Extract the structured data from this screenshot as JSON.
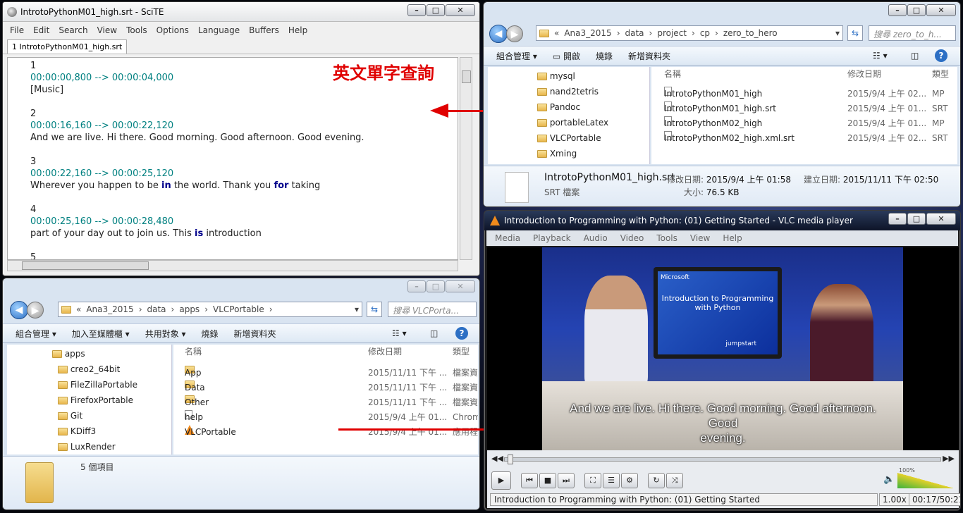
{
  "scite": {
    "title": "IntrotoPythonM01_high.srt - SciTE",
    "menu": [
      "File",
      "Edit",
      "Search",
      "View",
      "Tools",
      "Options",
      "Language",
      "Buffers",
      "Help"
    ],
    "tab": "1 IntrotoPythonM01_high.srt",
    "lines": [
      {
        "t": "1"
      },
      {
        "t": "00:00:00,800 --> 00:00:04,000"
      },
      {
        "t": "[Music]"
      },
      {
        "t": ""
      },
      {
        "t": "2"
      },
      {
        "t": "00:00:16,160 --> 00:00:22,120"
      },
      {
        "t": "And we are live. Hi there. Good morning. Good afternoon. Good evening."
      },
      {
        "t": ""
      },
      {
        "t": "3"
      },
      {
        "t": "00:00:22,160 --> 00:00:25,120"
      },
      {
        "pre": "Wherever you happen to be ",
        "kw": "in",
        "mid": " the world. Thank you ",
        "kw2": "for",
        "post": " taking"
      },
      {
        "t": ""
      },
      {
        "t": "4"
      },
      {
        "t": "00:00:25,160 --> 00:00:28,480"
      },
      {
        "pre": "part of your day out to join us. This ",
        "kw": "is",
        "post": " introduction"
      },
      {
        "t": ""
      },
      {
        "t": "5"
      }
    ]
  },
  "annotation": "英文單字查詢",
  "explorer_top": {
    "path": [
      "Ana3_2015",
      "data",
      "project",
      "cp",
      "zero_to_hero"
    ],
    "search_placeholder": "搜尋 zero_to_h...",
    "commands": [
      "組合管理 ▾",
      "開啟",
      "燒錄",
      "新增資料夾"
    ],
    "nav": [
      "mysql",
      "nand2tetris",
      "Pandoc",
      "portableLatex",
      "VLCPortable",
      "Xming"
    ],
    "headers": {
      "name": "名稱",
      "date": "修改日期",
      "type": "類型"
    },
    "files": [
      {
        "name": "IntrotoPythonM01_high",
        "date": "2015/9/4 上午 02...",
        "type": "MP"
      },
      {
        "name": "IntrotoPythonM01_high.srt",
        "date": "2015/9/4 上午 01...",
        "type": "SRT"
      },
      {
        "name": "IntrotoPythonM02_high",
        "date": "2015/9/4 上午 01...",
        "type": "MP"
      },
      {
        "name": "IntrotoPythonM02_high.xml.srt",
        "date": "2015/9/4 上午 02...",
        "type": "SRT"
      }
    ],
    "details": {
      "name": "IntrotoPythonM01_high.srt",
      "type": "SRT 檔案",
      "modified_label": "修改日期:",
      "modified": "2015/9/4 上午 01:58",
      "created_label": "建立日期:",
      "created": "2015/11/11 下午 02:50",
      "size_label": "大小:",
      "size": "76.5 KB"
    }
  },
  "explorer_bottom": {
    "path": [
      "Ana3_2015",
      "data",
      "apps",
      "VLCPortable"
    ],
    "search_placeholder": "搜尋 VLCPorta...",
    "commands": [
      "組合管理 ▾",
      "加入至媒體櫃 ▾",
      "共用對象 ▾",
      "燒錄",
      "新增資料夾"
    ],
    "nav": [
      "apps",
      "creo2_64bit",
      "FileZillaPortable",
      "FirefoxPortable",
      "Git",
      "KDiff3",
      "LuxRender"
    ],
    "headers": {
      "name": "名稱",
      "date": "修改日期",
      "type": "類型"
    },
    "files": [
      {
        "name": "App",
        "date": "2015/11/11 下午 ...",
        "type": "檔案資"
      },
      {
        "name": "Data",
        "date": "2015/11/11 下午 ...",
        "type": "檔案資"
      },
      {
        "name": "Other",
        "date": "2015/11/11 下午 ...",
        "type": "檔案資"
      },
      {
        "name": "help",
        "date": "2015/9/4 上午 01...",
        "type": "Chrom"
      },
      {
        "name": "VLCPortable",
        "date": "2015/9/4 上午 01...",
        "type": "應用程"
      }
    ],
    "count": "5 個項目"
  },
  "vlc": {
    "title": "Introduction to Programming with Python: (01) Getting Started - VLC media player",
    "menu": [
      "Media",
      "Playback",
      "Audio",
      "Video",
      "Tools",
      "View",
      "Help"
    ],
    "slide_brand": "Microsoft",
    "slide_title": "Introduction to Programming with Python",
    "slide_logo": "jumpstart",
    "subtitle1": "And we are live. Hi there. Good morning. Good afternoon.",
    "subtitle2": "Good",
    "subtitle3": "evening.",
    "volume": "100%",
    "status": "Introduction to Programming with Python: (01) Getting Started",
    "speed": "1.00x",
    "time": "00:17/50:21"
  }
}
